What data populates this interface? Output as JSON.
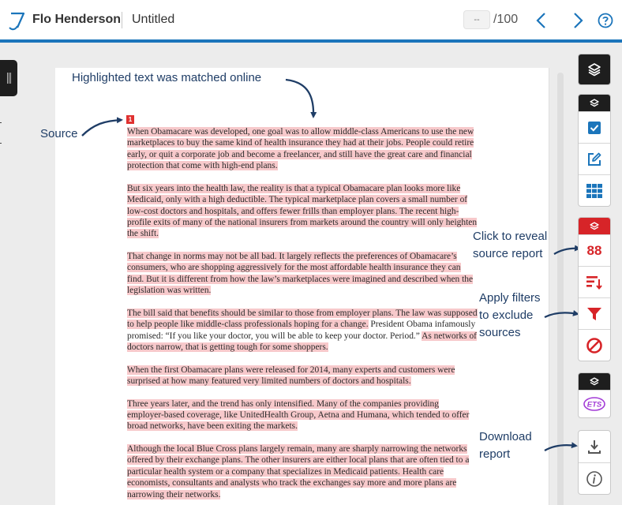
{
  "colors": {
    "accent_blue": "#1b75bb",
    "match_red": "#d72428",
    "highlight_pink": "#f7c9cb",
    "toolbar_dark": "#1e1e1e",
    "ets_purple": "#a23bd6",
    "annotation_navy": "#1f3d66"
  },
  "header": {
    "user_name": "Flo Henderson",
    "doc_title": "Untitled",
    "page_current": "--",
    "page_total": "/100"
  },
  "icons": {
    "logo": "turnitin-logo-icon",
    "prev": "chevron-left-icon",
    "next": "chevron-right-icon",
    "help": "help-circle-icon",
    "layers": "layers-icon",
    "grading": "checkbox-icon",
    "feedback": "edit-icon",
    "rubric": "grid-icon",
    "match_overview": "similarity-score-icon",
    "all_sources": "sort-list-icon",
    "filter": "filter-icon",
    "exclude": "exclude-icon",
    "ets": "ets-icon",
    "download": "download-icon",
    "info": "info-icon"
  },
  "document": {
    "match_number": "1",
    "paragraphs": [
      {
        "hl": "When Obamacare was developed, one goal was to allow middle-class Americans to use the new marketplaces to buy the same kind of health insurance they had at their jobs. People could retire early, or quit a corporate job and become a freelancer, and still have the great care and financial protection that come with high-end plans.",
        "plain": ""
      },
      {
        "hl": "But six years into the health law, the reality is that a typical Obamacare plan looks more like Medicaid, only with a high deductible. The typical marketplace plan covers a small number of low-cost doctors and hospitals, and offers fewer frills than employer plans. The recent high-profile exits of many of the national insurers from markets around the country will only heighten the shift.",
        "plain": ""
      },
      {
        "hl": "That change in norms may not be all bad. It largely reflects the preferences of Obamacare’s consumers, who are shopping aggressively for the most affordable health insurance they can find. But it is different from how the law’s marketplaces were imagined and described when the legislation was written.",
        "plain": ""
      },
      {
        "hl": "The bill said that benefits should be similar to those from employer plans. The law was supposed to help people like middle-class professionals hoping for a change.",
        "plain": " President Obama infamously promised: “If you like your doctor, you will be able to keep your doctor. Period.” ",
        "hl2": "As networks of doctors narrow, that is getting tough for some shoppers."
      },
      {
        "hl": "When the first Obamacare plans were released for 2014, many experts and customers were surprised at how many featured very limited numbers of doctors and hospitals.",
        "plain": ""
      },
      {
        "hl": "Three years later, and the trend has only intensified. Many of the companies providing employer-based coverage, like UnitedHealth Group, Aetna and Humana, which tended to offer broad networks, have been exiting the markets.",
        "plain": ""
      },
      {
        "hl": "Although the local Blue Cross plans largely remain, many are sharply narrowing the networks offered by their exchange plans. The other insurers are either local plans that are often tied to a particular health system or a company that specializes in Medicaid patients. Health care economists, consultants and analysts who track the exchanges say more and more plans are narrowing their networks.",
        "plain": ""
      }
    ]
  },
  "annotations": {
    "highlighted": "Highlighted text was matched online",
    "source": "Source",
    "click_reveal": [
      "Click to reveal",
      "source report"
    ],
    "apply_filters": [
      "Apply filters",
      "to exclude",
      "sources"
    ],
    "download": [
      "Download",
      "report"
    ]
  },
  "toolbar": {
    "similarity_score": "88",
    "ets_label": "ETS"
  }
}
